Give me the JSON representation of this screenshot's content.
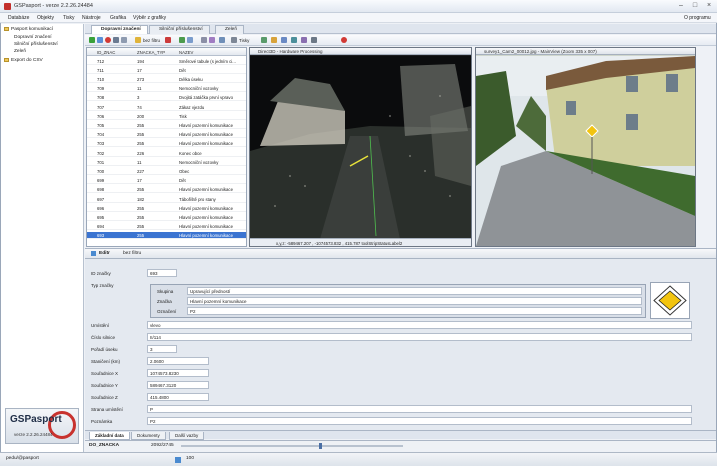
{
  "window": {
    "title": "GSPasport - verze 2.2.26.24484",
    "right_label": "O programu"
  },
  "menu": [
    "Databáze",
    "Objekty",
    "Tisky",
    "Nástroje",
    "Grafika",
    "Výběr z grafiky"
  ],
  "sidebar": {
    "items": [
      "Pasport komunikací",
      "Dopravní značení",
      "Silniční příslušenství",
      "Zeleň",
      "Export do CSV"
    ]
  },
  "logo": {
    "name": "GSPasport",
    "version": "verze 2.2.26.24484"
  },
  "doc_tabs": [
    "Dopravní značení",
    "Silniční příslušenství",
    "Zeleň"
  ],
  "toolbar": {
    "filter_label": "bez filtru",
    "tisky_label": "Tisky"
  },
  "grid": {
    "columns": [
      "ID_ZNAC",
      "ZNACKA_TYP",
      "NAZEV"
    ],
    "rows": [
      [
        "712",
        "194",
        "Směrové tabule (s jedním ci..."
      ],
      [
        "711",
        "17",
        "Dět"
      ],
      [
        "710",
        "273",
        "Délka úseku"
      ],
      [
        "709",
        "11",
        "Nemocniční vozovky"
      ],
      [
        "708",
        "3",
        "Dvojitá zatáčka první vpravo"
      ],
      [
        "707",
        "74",
        "Zákaz vjezdu"
      ],
      [
        "706",
        "200",
        "Tisk"
      ],
      [
        "705",
        "255",
        "Hlavní pozemní komunikace"
      ],
      [
        "704",
        "255",
        "Hlavní pozemní komunikace"
      ],
      [
        "703",
        "255",
        "Hlavní pozemní komunikace"
      ],
      [
        "702",
        "226",
        "Konec obce"
      ],
      [
        "701",
        "11",
        "Nemocniční vozovky"
      ],
      [
        "700",
        "227",
        "Obec"
      ],
      [
        "699",
        "17",
        "Dět"
      ],
      [
        "698",
        "255",
        "Hlavní pozemní komunikace"
      ],
      [
        "697",
        "182",
        "Tábořiště pro stany"
      ],
      [
        "696",
        "255",
        "Hlavní pozemní komunikace"
      ],
      [
        "695",
        "255",
        "Hlavní pozemní komunikace"
      ],
      [
        "694",
        "255",
        "Hlavní pozemní komunikace"
      ],
      [
        "693",
        "255",
        "Hlavní pozemní komunikace"
      ]
    ],
    "selected_index": 19
  },
  "viewer_left": {
    "title": "Direct3D - Hardware Processing",
    "status": "x,y,z: -589467.207 , -1074573.832 , 415.787   toolStripStatusLabel2"
  },
  "viewer_right": {
    "title": "survey1_Cam2_00012.jpg - MainView (Zoom 335 x 007)"
  },
  "detail_tabs": {
    "edit": "Editr",
    "filter": "bez filtru"
  },
  "detail": {
    "fields": [
      {
        "label": "ID značky",
        "value": "693"
      },
      {
        "label": "Typ značky",
        "value": ""
      },
      {
        "label": "Umístění",
        "value": "vlevo"
      },
      {
        "label": "Číslo silnice",
        "value": "II/114"
      },
      {
        "label": "Pořadí úseku",
        "value": "3"
      },
      {
        "label": "Staničení (km)",
        "value": "2.0600"
      },
      {
        "label": "Souřadnice X",
        "value": "1074573.8230"
      },
      {
        "label": "Souřadnice Y",
        "value": "589467.3120"
      },
      {
        "label": "Souřadnice Z",
        "value": "415.4800"
      },
      {
        "label": "Strana umístění",
        "value": "P"
      },
      {
        "label": "Poznámka",
        "value": "P2"
      }
    ],
    "group": [
      {
        "label": "Skupina",
        "value": "Upravující předností"
      },
      {
        "label": "Značka",
        "value": "Hlavní pozemní komunikace"
      },
      {
        "label": "Označení",
        "value": "P2"
      }
    ]
  },
  "bottom_tabs": [
    "Základní data",
    "Dokumenty",
    "Další vazby"
  ],
  "position_bar": {
    "field": "DO_ZNACKA",
    "position": "2092/2745"
  },
  "statusbar": {
    "user": "pedu/@pasport",
    "zoom": "100"
  },
  "colors": {
    "selection": "#3b74d1",
    "brand_red": "#c8322e",
    "sign_yellow": "#f2c40f"
  }
}
